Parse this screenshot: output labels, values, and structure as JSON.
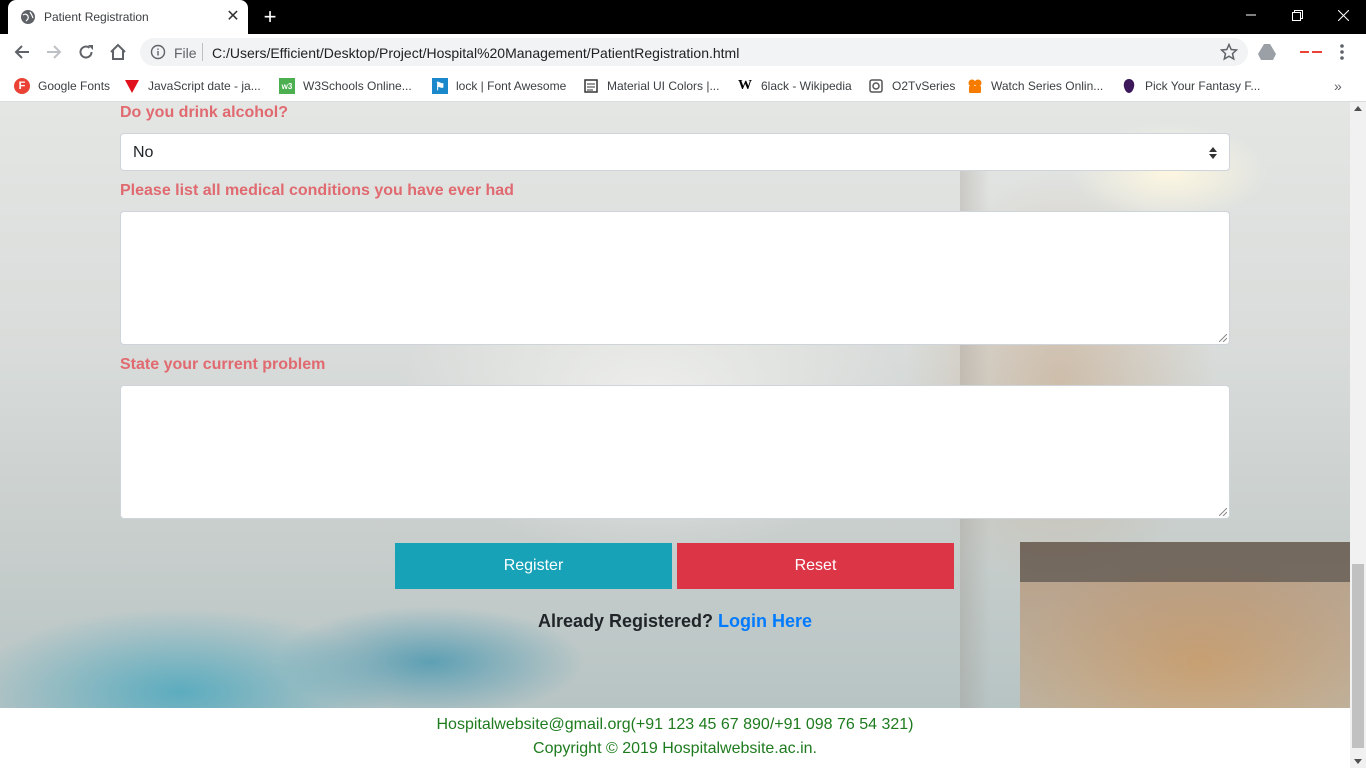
{
  "browser": {
    "tab_title": "Patient Registration",
    "address_scheme_label": "File",
    "url": "C:/Users/Efficient/Desktop/Project/Hospital%20Management/PatientRegistration.html",
    "bookmarks": [
      {
        "label": "Google Fonts",
        "icon": "google-fonts-icon",
        "color": "#ea4335"
      },
      {
        "label": "JavaScript date - ja...",
        "icon": "javascript-date-icon",
        "color": "#e0101d"
      },
      {
        "label": "W3Schools Online...",
        "icon": "w3schools-icon",
        "color": "#4caf50"
      },
      {
        "label": "lock | Font Awesome",
        "icon": "font-awesome-flag-icon",
        "color": "#1c88cc"
      },
      {
        "label": "Material UI Colors |...",
        "icon": "material-ui-icon",
        "color": "#333333"
      },
      {
        "label": "6lack - Wikipedia",
        "icon": "wikipedia-icon",
        "color": "#000000"
      },
      {
        "label": "O2TvSeries",
        "icon": "o2tvseries-icon",
        "color": "#555555"
      },
      {
        "label": "Watch Series Onlin...",
        "icon": "watch-series-icon",
        "color": "#f57c00"
      },
      {
        "label": "Pick Your Fantasy F...",
        "icon": "premier-league-icon",
        "color": "#3d195b"
      }
    ]
  },
  "form": {
    "alcohol_label": "Do you drink alcohol?",
    "alcohol_value": "No",
    "conditions_label": "Please list all medical conditions you have ever had",
    "conditions_value": "",
    "problem_label": "State your current problem",
    "problem_value": "",
    "register_button": "Register",
    "reset_button": "Reset",
    "already_text": "Already Registered?",
    "login_link": "Login Here"
  },
  "footer": {
    "contact": "Hospitalwebsite@gmail.org(+91 123 45 67 890/+91 098 76 54 321)",
    "copyright": "Copyright © 2019 Hospitalwebsite.ac.in."
  },
  "colors": {
    "label": "#e06a70",
    "register": "#17a2b8",
    "reset": "#dc3545",
    "link": "#007bff",
    "footer_text": "#1e7b1e"
  }
}
